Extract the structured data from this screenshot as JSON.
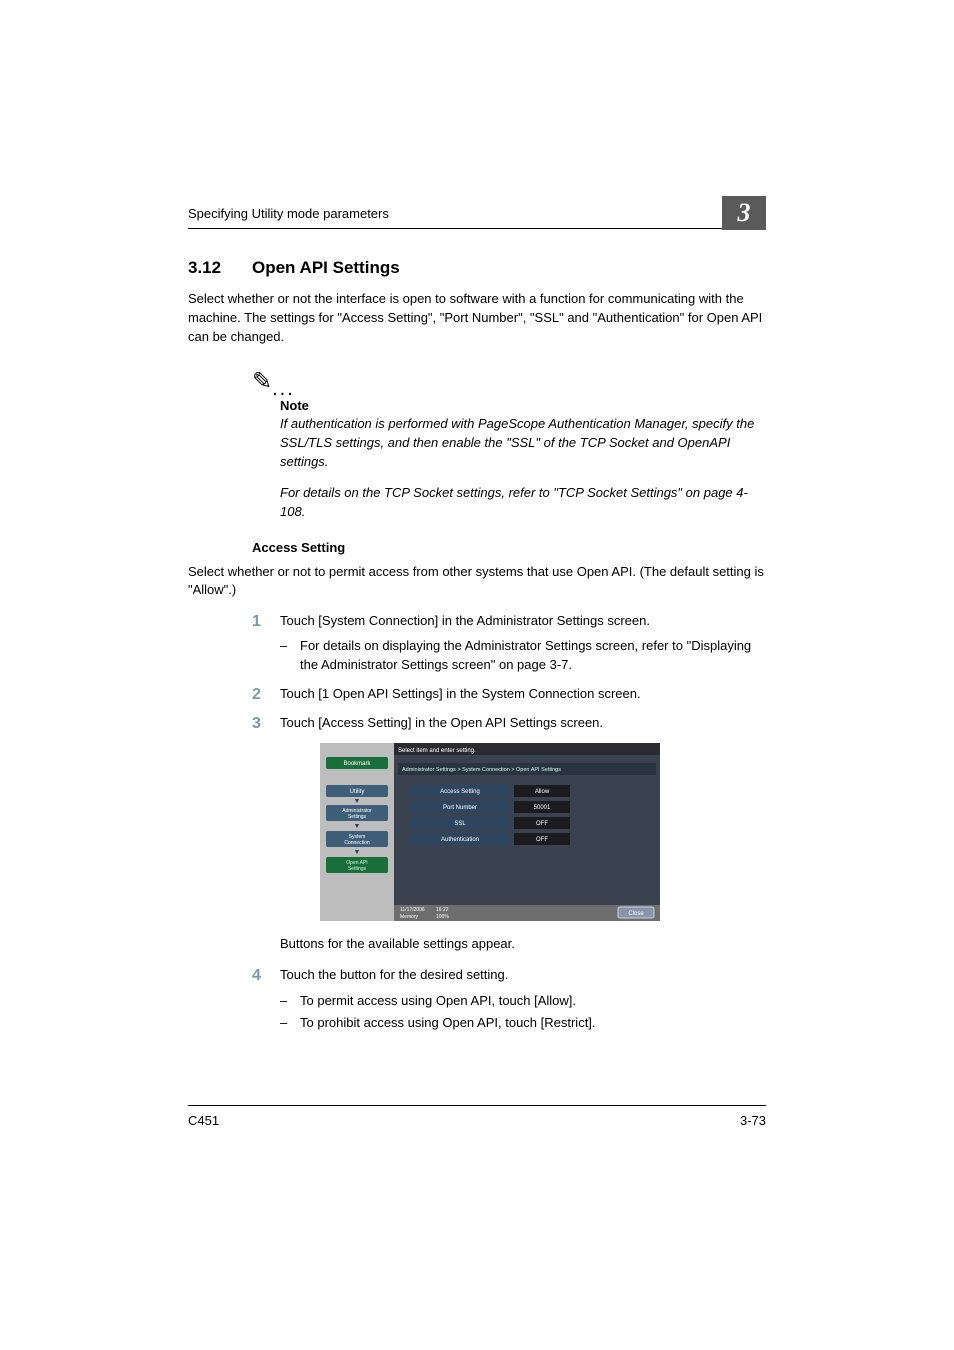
{
  "header": {
    "running_head": "Specifying Utility mode parameters",
    "chapter_number": "3"
  },
  "section": {
    "number": "3.12",
    "title": "Open API Settings"
  },
  "intro": "Select whether or not the interface is open to software with a function for communicating with the machine. The settings for \"Access Setting\", \"Port Number\", \"SSL\" and \"Authentication\" for Open API can be changed.",
  "note": {
    "heading": "Note",
    "p1": "If authentication is performed with PageScope Authentication Manager, specify the SSL/TLS settings, and then enable the \"SSL\" of the TCP Socket and OpenAPI settings.",
    "p2": "For details on the TCP Socket settings, refer to \"TCP Socket Settings\" on page 4-108."
  },
  "access": {
    "heading": "Access Setting",
    "intro": "Select whether or not to permit access from other systems that use Open API. (The default setting is \"Allow\".)"
  },
  "steps": {
    "s1": "Touch [System Connection] in the Administrator Settings screen.",
    "s1_sub1": "For details on displaying the Administrator Settings screen, refer to \"Displaying the Administrator Settings screen\" on page 3-7.",
    "s2": "Touch [1 Open API Settings] in the System Connection screen.",
    "s3": "Touch [Access Setting] in the Open API Settings screen.",
    "after_image": "Buttons for the available settings appear.",
    "s4": "Touch the button for the desired setting.",
    "s4_sub1": "To permit access using Open API, touch [Allow].",
    "s4_sub2": "To prohibit access using Open API, touch [Restrict]."
  },
  "screenshot": {
    "top_instruction": "Select item and enter setting.",
    "breadcrumb": "Administrator Settings > System Connection > Open API Settings",
    "sidebar": {
      "bookmark": "Bookmark",
      "utility": "Utility",
      "admin": "Administrator Settings",
      "system": "System Connection",
      "openapi": "Open API Settings"
    },
    "rows": {
      "access_label": "Access Setting",
      "access_value": "Allow",
      "port_label": "Port Number",
      "port_value": "50001",
      "ssl_label": "SSL",
      "ssl_value": "OFF",
      "auth_label": "Authentication",
      "auth_value": "OFF"
    },
    "status": {
      "date": "11/17/2006",
      "time": "16:22",
      "memory_label": "Memory",
      "memory_value": "100%"
    },
    "close": "Close"
  },
  "footer": {
    "left": "C451",
    "right": "3-73"
  }
}
